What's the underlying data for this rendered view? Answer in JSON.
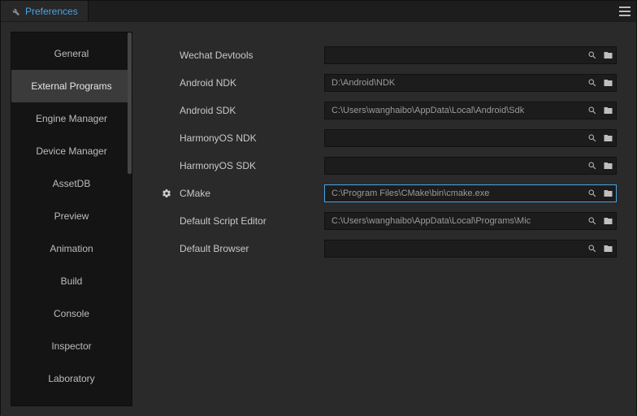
{
  "titlebar": {
    "tab_label": "Preferences"
  },
  "sidebar": {
    "items": [
      {
        "label": "General"
      },
      {
        "label": "External Programs"
      },
      {
        "label": "Engine Manager"
      },
      {
        "label": "Device Manager"
      },
      {
        "label": "AssetDB"
      },
      {
        "label": "Preview"
      },
      {
        "label": "Animation"
      },
      {
        "label": "Build"
      },
      {
        "label": "Console"
      },
      {
        "label": "Inspector"
      },
      {
        "label": "Laboratory"
      }
    ],
    "active_index": 1
  },
  "form": {
    "rows": [
      {
        "label": "Wechat Devtools",
        "value": "",
        "has_gear": false,
        "focused": false
      },
      {
        "label": "Android NDK",
        "value": "D:\\Android\\NDK",
        "has_gear": false,
        "focused": false
      },
      {
        "label": "Android SDK",
        "value": "C:\\Users\\wanghaibo\\AppData\\Local\\Android\\Sdk",
        "has_gear": false,
        "focused": false
      },
      {
        "label": "HarmonyOS NDK",
        "value": "",
        "has_gear": false,
        "focused": false
      },
      {
        "label": "HarmonyOS SDK",
        "value": "",
        "has_gear": false,
        "focused": false
      },
      {
        "label": "CMake",
        "value": "C:\\Program Files\\CMake\\bin\\cmake.exe",
        "has_gear": true,
        "focused": true
      },
      {
        "label": "Default Script Editor",
        "value": "C:\\Users\\wanghaibo\\AppData\\Local\\Programs\\Mic",
        "has_gear": false,
        "focused": false
      },
      {
        "label": "Default Browser",
        "value": "",
        "has_gear": false,
        "focused": false
      }
    ]
  },
  "colors": {
    "accent": "#4aa3df",
    "bg": "#2a2a2a",
    "panel": "#141414",
    "input": "#1c1c1c"
  }
}
